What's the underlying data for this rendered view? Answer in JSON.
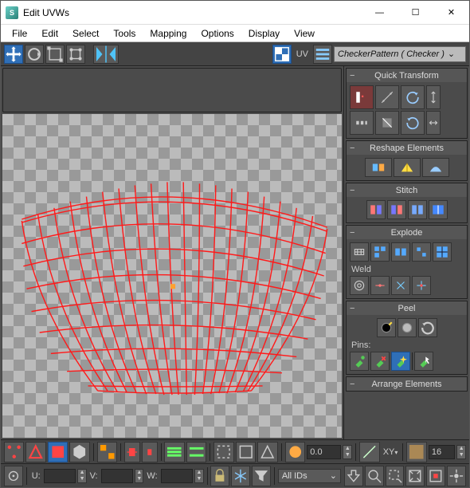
{
  "window": {
    "title": "Edit UVWs",
    "min": "—",
    "max": "☐",
    "close": "✕"
  },
  "menu": {
    "file": "File",
    "edit": "Edit",
    "select": "Select",
    "tools": "Tools",
    "mapping": "Mapping",
    "options": "Options",
    "display": "Display",
    "view": "View"
  },
  "top_toolbar": {
    "uv_label": "UV",
    "map_dropdown": "CheckerPattern  ( Checker )"
  },
  "rollouts": {
    "quick_transform": "Quick Transform",
    "reshape": "Reshape Elements",
    "stitch": "Stitch",
    "explode": "Explode",
    "weld": "Weld",
    "peel": "Peel",
    "pins": "Pins:",
    "arrange": "Arrange Elements"
  },
  "bottom": {
    "all_ids": "All IDs",
    "zero": "0.0",
    "xy": "XY",
    "sixteen": "16",
    "u_label": "U:",
    "v_label": "V:",
    "w_label": "W:",
    "u_val": "",
    "v_val": "",
    "w_val": ""
  }
}
